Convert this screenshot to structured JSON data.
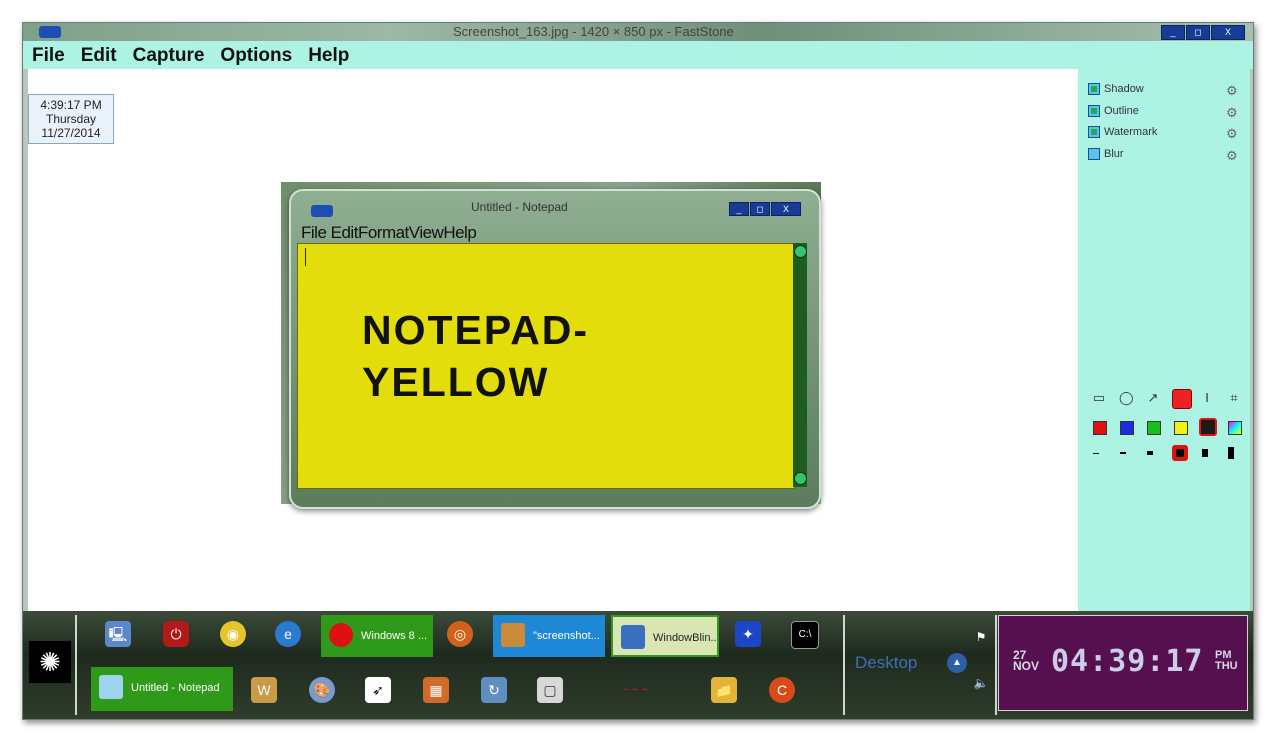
{
  "window": {
    "title": "Screenshot_163.jpg - 1420 × 850 px - FastStone",
    "controls": {
      "minimize": "_",
      "maximize": "◻",
      "close": "X"
    }
  },
  "menu": [
    "File",
    "Edit",
    "Capture",
    "Options",
    "Help"
  ],
  "canvas": {
    "clock_time": "4:39:17 PM",
    "clock_day": "Thursday",
    "clock_date": "11/27/2014"
  },
  "notepad": {
    "title": "Untitled - Notepad",
    "menu": [
      "File",
      "Edit",
      "Format",
      "View",
      "Help"
    ],
    "content_line1": "NOTEPAD-",
    "content_line2": "YELLOW",
    "background_color": "#e3dd0c"
  },
  "right_panel": {
    "options": [
      {
        "label": "Shadow",
        "checked": true
      },
      {
        "label": "Outline",
        "checked": true
      },
      {
        "label": "Watermark",
        "checked": true
      },
      {
        "label": "Blur",
        "checked": false
      }
    ],
    "tools": [
      "rectangle-icon",
      "ellipse-icon",
      "arrow-icon",
      "highlighter-icon",
      "text-cursor-icon",
      "crop-icon"
    ],
    "colors": [
      "#e31010",
      "#1a2ee0",
      "#16c21a",
      "#f2f20a",
      "#1b1b1b",
      "rainbow"
    ],
    "line_widths": [
      "1",
      "2",
      "3",
      "4",
      "5",
      "6"
    ]
  },
  "taskbar": {
    "tasks": [
      {
        "label": "Windows 8 ...",
        "color": "#2f9a1a"
      },
      {
        "label": "\"screenshot...",
        "color": "#1e88d6"
      },
      {
        "label": "WindowBlin...",
        "color": "#d9e6b4"
      },
      {
        "label": "Untitled - Notepad",
        "color": "#2f9a1a"
      }
    ],
    "desktop_label": "Desktop",
    "clock": {
      "day_num": "27",
      "month": "NOV",
      "time": "04:39:17",
      "ampm": "PM",
      "weekday": "THU"
    }
  }
}
